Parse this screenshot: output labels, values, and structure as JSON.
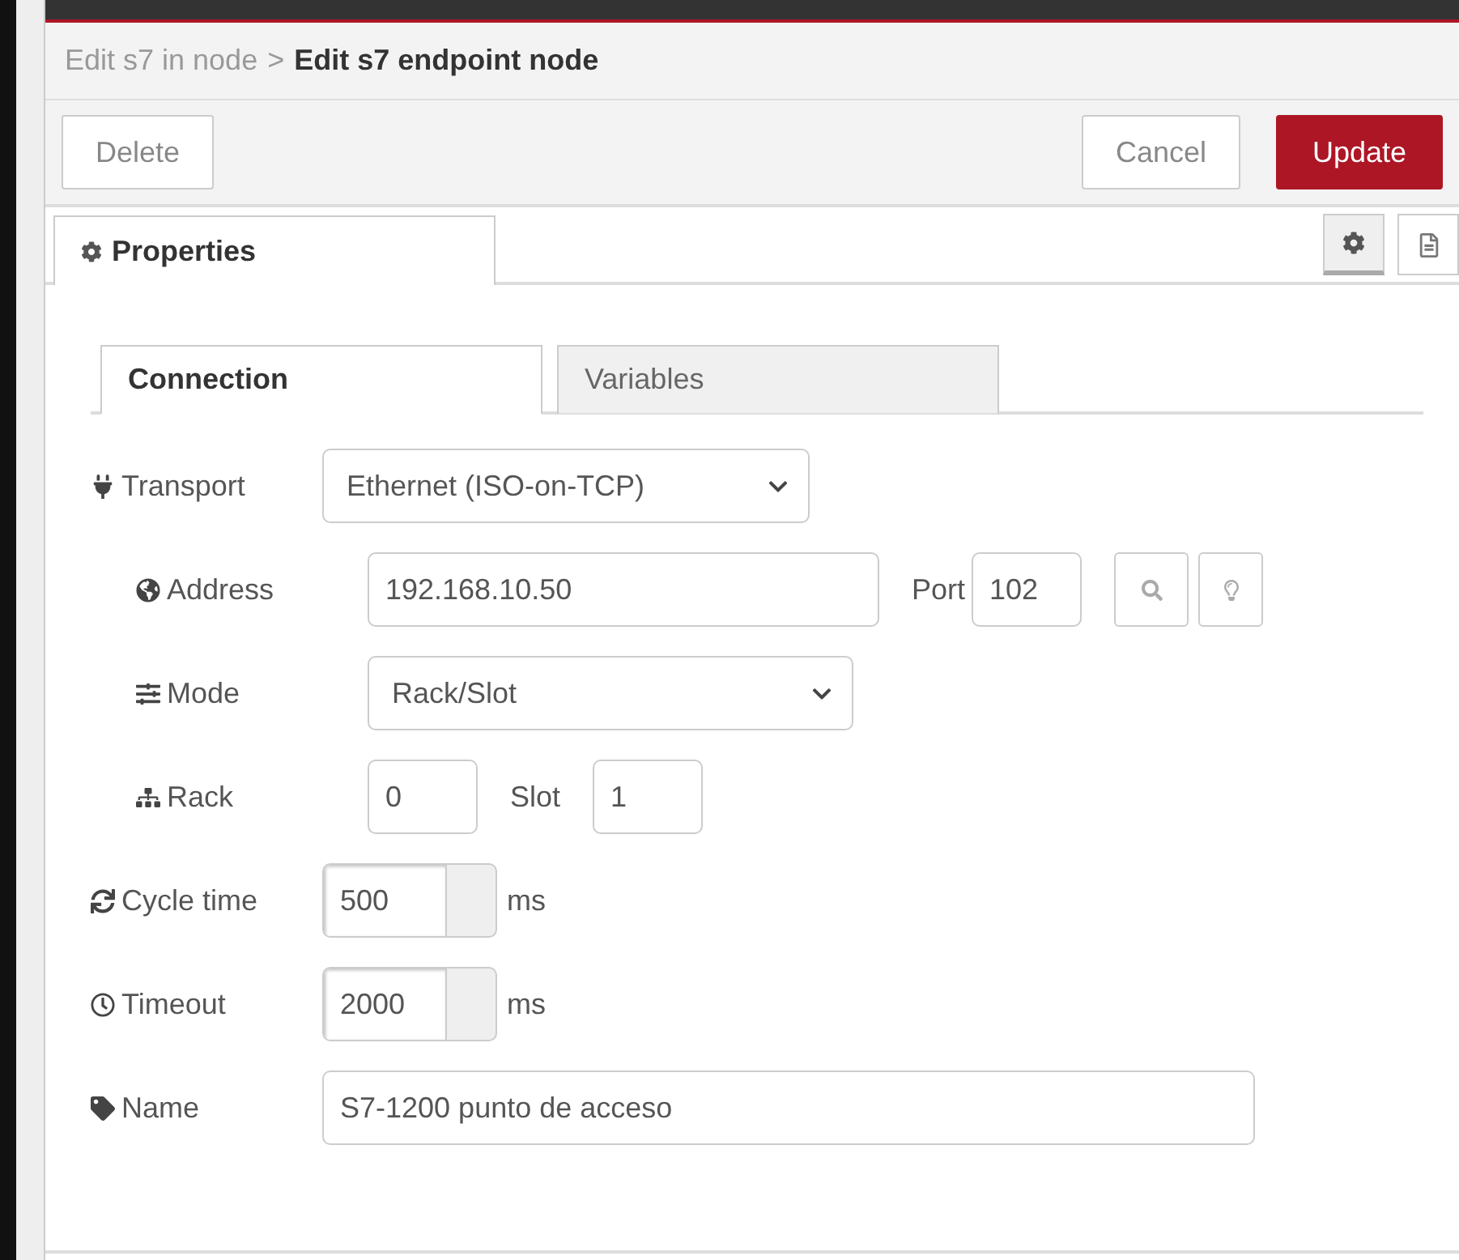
{
  "breadcrumb": {
    "parent": "Edit s7 in node",
    "separator": ">",
    "current": "Edit s7 endpoint node"
  },
  "buttons": [
    {
      "label": "Delete",
      "kind": "plain"
    },
    {
      "label": "Cancel",
      "kind": "plain"
    },
    {
      "label": "Update",
      "kind": "primary"
    }
  ],
  "tabs": [
    {
      "label": "Properties",
      "selected": true
    }
  ],
  "side_tabs": [
    {
      "kind": "settings",
      "selected": true
    },
    {
      "kind": "info",
      "selected": false
    }
  ],
  "subtabs": [
    {
      "label": "Connection",
      "selected": true
    },
    {
      "label": "Variables",
      "selected": false
    }
  ],
  "fields": [
    {
      "kind": "select",
      "label": "Transport",
      "value": "Ethernet (ISO-on-TCP)",
      "children": [
        {
          "kind": "address",
          "label": "Address",
          "value": "192.168.10.50",
          "port_label": "Port",
          "port_value": "102"
        },
        {
          "kind": "select",
          "label": "Mode",
          "value": "Rack/Slot"
        },
        {
          "kind": "rack_slot",
          "label": "Rack",
          "value": "0",
          "slot_label": "Slot",
          "slot_value": "1"
        }
      ]
    },
    {
      "kind": "spinner",
      "label": "Cycle time",
      "value": "500",
      "unit": "ms"
    },
    {
      "kind": "spinner",
      "label": "Timeout",
      "value": "2000",
      "unit": "ms"
    },
    {
      "kind": "text",
      "label": "Name",
      "value": "S7-1200 punto de acceso"
    }
  ]
}
